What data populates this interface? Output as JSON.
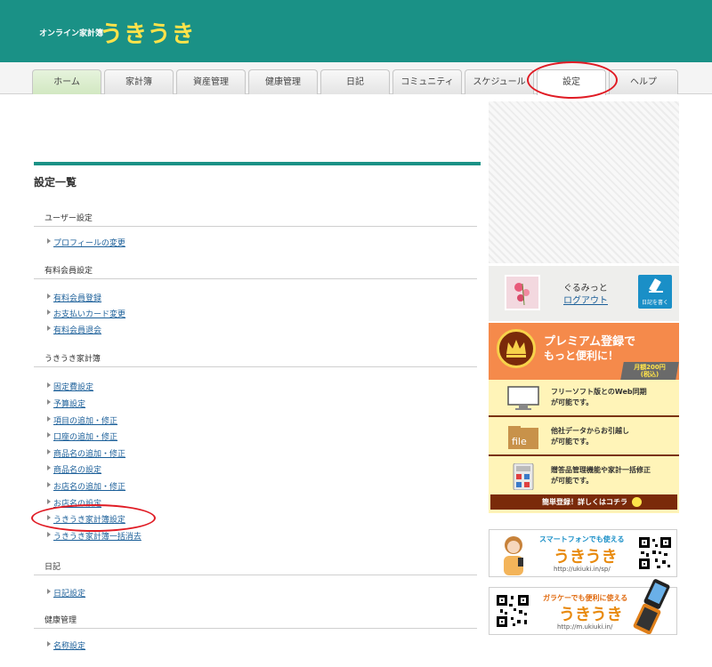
{
  "header": {
    "subtitle": "オンライン家計簿",
    "logo": "うきうき",
    "bg_color": "#1a9186"
  },
  "nav": {
    "tabs": [
      {
        "label": "ホーム"
      },
      {
        "label": "家計簿"
      },
      {
        "label": "資産管理"
      },
      {
        "label": "健康管理"
      },
      {
        "label": "日記"
      },
      {
        "label": "コミュニティ"
      },
      {
        "label": "スケジュール"
      },
      {
        "label": "設定"
      },
      {
        "label": "ヘルプ"
      }
    ],
    "active": "設定"
  },
  "main": {
    "title": "設定一覧",
    "sections": [
      {
        "heading": "ユーザー設定",
        "links": [
          "プロフィールの変更"
        ]
      },
      {
        "heading": "有料会員設定",
        "links": [
          "有料会員登録",
          "お支払いカード変更",
          "有料会員退会"
        ]
      },
      {
        "heading": "うきうき家計簿",
        "links": [
          "固定費設定",
          "予算設定",
          "項目の追加・修正",
          "口座の追加・修正",
          "商品名の追加・修正",
          "商品名の設定",
          "お店名の追加・修正",
          "お店名の設定",
          "うきうき家計簿設定",
          "うきうき家計簿一括消去"
        ]
      },
      {
        "heading": "日記",
        "links": [
          "日記設定"
        ]
      },
      {
        "heading": "健康管理",
        "links": [
          "名称設定"
        ]
      }
    ]
  },
  "sidebar": {
    "user": {
      "name": "ぐるみっと",
      "logout": "ログアウト",
      "diary_button": "日記を書く"
    },
    "premium": {
      "title": "プレミアム登録で",
      "subtitle": "もっと便利に！",
      "price": "月額200円",
      "price_note": "(税込)",
      "features": [
        {
          "line1": "フリーソフト版とのWeb同期",
          "line2": "が可能です。"
        },
        {
          "line1": "他社データからお引越し",
          "line2": "が可能です。"
        },
        {
          "line1": "贈答品管理機能や家計一括修正",
          "line2": "が可能です。"
        }
      ],
      "file_icon_label": "file",
      "footer": "簡単登録！詳しくはコチラ"
    },
    "smartphone_banner": {
      "caption": "スマートフォンでも使える",
      "logo": "うきうき",
      "url": "http://ukiuki.in/sp/"
    },
    "keitai_banner": {
      "caption": "ガラケーでも便利に使える",
      "logo": "うきうき",
      "url": "http://m.ukiuki.in/"
    }
  }
}
